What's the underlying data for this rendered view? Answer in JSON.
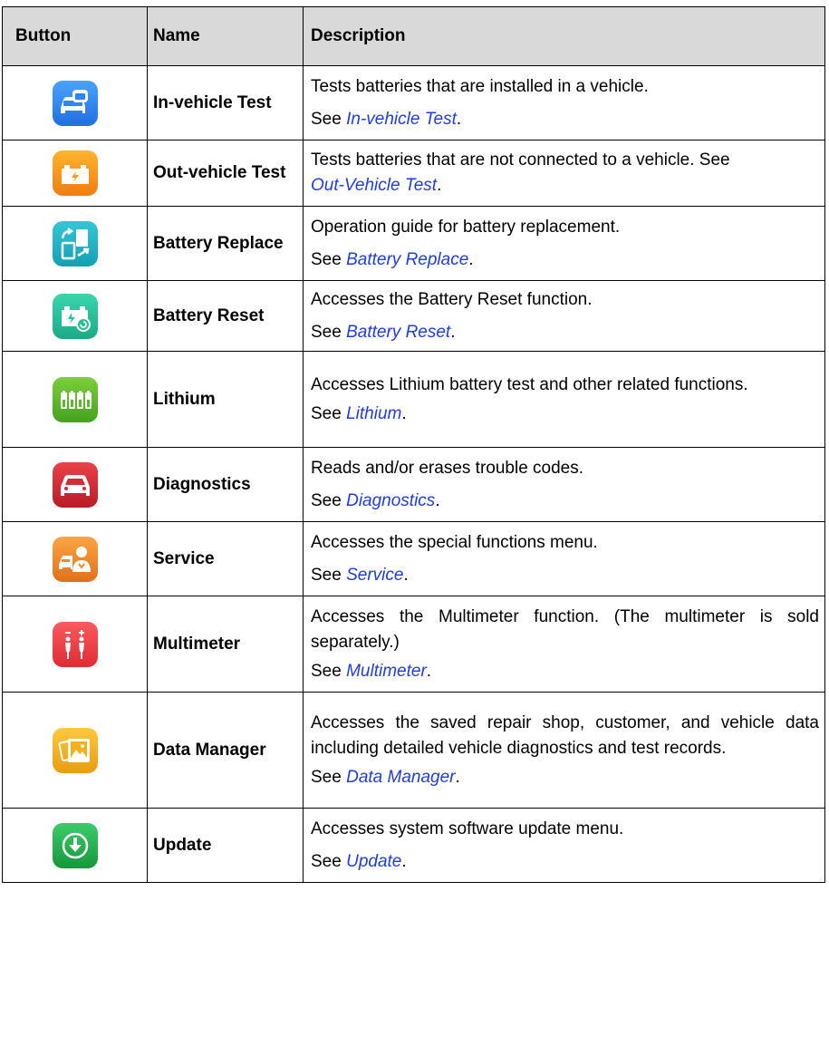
{
  "table": {
    "headers": {
      "button": "Button",
      "name": "Name",
      "description": "Description"
    },
    "rows": [
      {
        "icon": "in-vehicle-test-icon",
        "name": "In-vehicle Test",
        "description": "Tests batteries that are installed in a vehicle.",
        "see_prefix": "See ",
        "link": "In-vehicle Test",
        "see_suffix": "."
      },
      {
        "icon": "out-vehicle-test-icon",
        "name": "Out-vehicle Test",
        "description": "Tests batteries that are not connected to a vehicle. See",
        "see_prefix": "",
        "link": "Out-Vehicle Test",
        "see_suffix": "."
      },
      {
        "icon": "battery-replace-icon",
        "name": "Battery Replace",
        "description": "Operation guide for battery replacement.",
        "see_prefix": "See ",
        "link": "Battery Replace",
        "see_suffix": "."
      },
      {
        "icon": "battery-reset-icon",
        "name": "Battery Reset",
        "description": "Accesses the Battery Reset function.",
        "see_prefix": "See ",
        "link": "Battery Reset",
        "see_suffix": "."
      },
      {
        "icon": "lithium-icon",
        "name": "Lithium",
        "description": "Accesses Lithium battery test and other related functions.",
        "see_prefix": "See ",
        "link": "Lithium",
        "see_suffix": "."
      },
      {
        "icon": "diagnostics-icon",
        "name": "Diagnostics",
        "description": "Reads and/or erases trouble codes.",
        "see_prefix": "See ",
        "link": "Diagnostics",
        "see_suffix": "."
      },
      {
        "icon": "service-icon",
        "name": "Service",
        "description": "Accesses the special functions menu.",
        "see_prefix": "See ",
        "link": "Service",
        "see_suffix": "."
      },
      {
        "icon": "multimeter-icon",
        "name": "Multimeter",
        "description": "Accesses the Multimeter function. (The multimeter is sold separately.)",
        "see_prefix": "See ",
        "link": "Multimeter",
        "see_suffix": "."
      },
      {
        "icon": "data-manager-icon",
        "name": "Data Manager",
        "description": "Accesses the saved repair shop, customer, and vehicle data including detailed vehicle diagnostics and test records.",
        "see_prefix": "See ",
        "link": "Data Manager",
        "see_suffix": "."
      },
      {
        "icon": "update-icon",
        "name": "Update",
        "description": "Accesses system software update menu.",
        "see_prefix": "See ",
        "link": "Update",
        "see_suffix": "."
      }
    ]
  },
  "colors": {
    "link": "#1f3de0",
    "header_bg": "#d9d9d9",
    "in_vehicle": "#2f86f0",
    "out_vehicle": "#f39a16",
    "battery_replace": "#1fb3c8",
    "battery_reset": "#27c29a",
    "lithium": "#5ab82a",
    "diagnostics": "#d62b35",
    "service": "#f08a26",
    "multimeter": "#ee3f45",
    "data_manager": "#f2b21c",
    "update": "#22b14c"
  }
}
